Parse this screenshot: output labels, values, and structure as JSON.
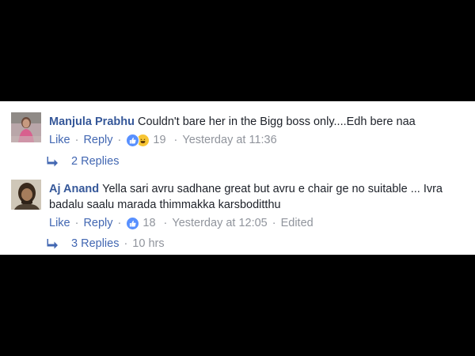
{
  "colors": {
    "background": "#000000",
    "panel": "#ffffff",
    "author": "#365899",
    "link": "#4267b2",
    "meta": "#90949c",
    "like_badge": "#5890ff",
    "haha_badge": "#f7c534"
  },
  "comments": [
    {
      "author": "Manjula Prabhu",
      "text": "Couldn't bare her in the Bigg boss only....Edh bere naa",
      "like_label": "Like",
      "reply_label": "Reply",
      "reactions": [
        "like-icon",
        "haha-icon"
      ],
      "reaction_count": "19",
      "timestamp": "Yesterday at 11:36",
      "edited_label": "",
      "replies_label": "2 Replies",
      "replies_time": ""
    },
    {
      "author": "Aj Anand",
      "text": "Yella sari avru sadhane great but avru e chair ge no suitable ... Ivra badalu saalu marada thimmakka karsboditthu",
      "like_label": "Like",
      "reply_label": "Reply",
      "reactions": [
        "like-icon"
      ],
      "reaction_count": "18",
      "timestamp": "Yesterday at 12:05",
      "edited_label": "Edited",
      "replies_label": "3 Replies",
      "replies_time": "10 hrs"
    }
  ],
  "separator": "·"
}
